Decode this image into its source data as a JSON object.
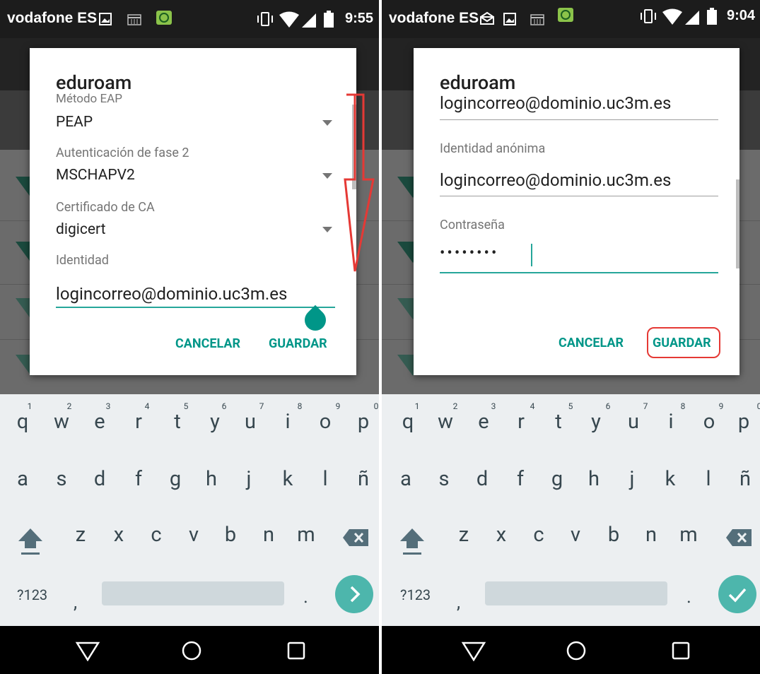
{
  "left": {
    "status": {
      "carrier": "vodafone ES",
      "time": "9:55"
    },
    "dialog": {
      "title": "eduroam",
      "eap_label": "Método EAP",
      "eap_value": "PEAP",
      "phase2_label": "Autenticación de fase 2",
      "phase2_value": "MSCHAPV2",
      "ca_label": "Certificado de CA",
      "ca_value": "digicert",
      "identity_label": "Identidad",
      "identity_value": "logincorreo@dominio.uc3m.es",
      "cancel": "CANCELAR",
      "save": "GUARDAR"
    }
  },
  "right": {
    "status": {
      "carrier": "vodafone ES",
      "time": "9:04"
    },
    "dialog": {
      "title": "eduroam",
      "identity_value": "logincorreo@dominio.uc3m.es",
      "anon_label": "Identidad anónima",
      "anon_value": "logincorreo@dominio.uc3m.es",
      "password_label": "Contraseña",
      "password_value": "••••••••",
      "cancel": "CANCELAR",
      "save": "GUARDAR"
    }
  },
  "keyboard": {
    "row1": [
      "q",
      "w",
      "e",
      "r",
      "t",
      "y",
      "u",
      "i",
      "o",
      "p"
    ],
    "hints": [
      "1",
      "2",
      "3",
      "4",
      "5",
      "6",
      "7",
      "8",
      "9",
      "0"
    ],
    "row2": [
      "a",
      "s",
      "d",
      "f",
      "g",
      "h",
      "j",
      "k",
      "l",
      "ñ"
    ],
    "row3": [
      "z",
      "x",
      "c",
      "v",
      "b",
      "n",
      "m"
    ],
    "symbols": "?123",
    "comma": ",",
    "period": "."
  },
  "colors": {
    "accent": "#009688",
    "annotation": "#e53935"
  },
  "icons": [
    "image-icon",
    "calendar-icon",
    "messenger-icon",
    "mail-icon",
    "vibrate-icon",
    "wifi-icon",
    "signal-icon",
    "battery-icon",
    "shift-icon",
    "backspace-icon",
    "chevron-right-icon",
    "check-icon",
    "back-icon",
    "home-icon",
    "recents-icon"
  ]
}
